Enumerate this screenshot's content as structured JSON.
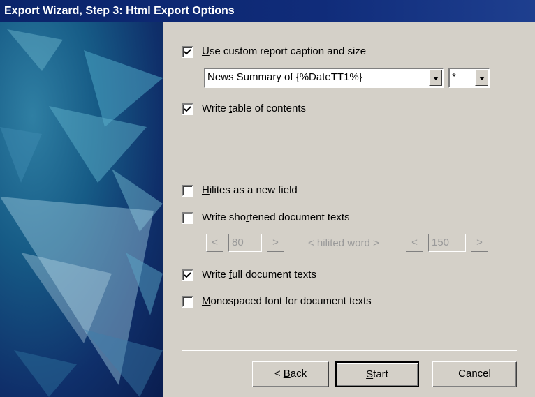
{
  "window": {
    "title": "Export Wizard, Step 3: Html Export Options"
  },
  "options": {
    "custom_caption": {
      "pre": "",
      "ul": "U",
      "post": "se custom report caption and size",
      "checked": true
    },
    "caption_combo": {
      "value": "News Summary of {%DateTT1%}"
    },
    "size_combo": {
      "value": "*"
    },
    "toc": {
      "pre": "Write ",
      "ul": "t",
      "post": "able of contents",
      "checked": true
    },
    "hilites": {
      "pre": "",
      "ul": "H",
      "post": "ilites as a new field",
      "checked": false
    },
    "shortened": {
      "pre": "Write sho",
      "ul": "r",
      "post": "tened document texts",
      "checked": false
    },
    "spinner_left": {
      "dec": "<",
      "value": "80",
      "inc": ">"
    },
    "hilited_word": "< hilited word >",
    "spinner_right": {
      "dec": "<",
      "value": "150",
      "inc": ">"
    },
    "full_texts": {
      "pre": "Write ",
      "ul": "f",
      "post": "ull document texts",
      "checked": true
    },
    "monospaced": {
      "pre": "",
      "ul": "M",
      "post": "onospaced font for document texts",
      "checked": false
    }
  },
  "buttons": {
    "back": {
      "pre": "< ",
      "ul": "B",
      "post": "ack"
    },
    "start": {
      "pre": "",
      "ul": "S",
      "post": "tart"
    },
    "cancel": {
      "pre": "Cancel",
      "ul": "",
      "post": ""
    }
  },
  "icons": {
    "check": "check-mark-icon",
    "dropdown": "chevron-down-icon"
  }
}
